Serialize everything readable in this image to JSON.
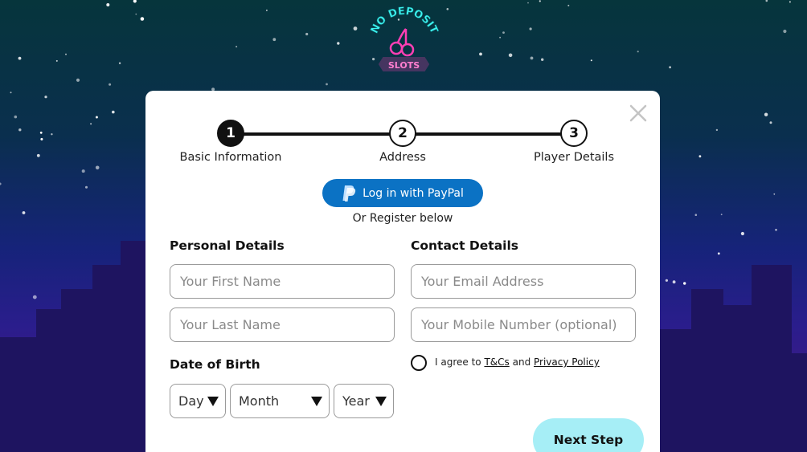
{
  "logo": {
    "text_top": "NO DEPOSIT",
    "text_bottom": "SLOTS"
  },
  "steps": [
    {
      "number": "1",
      "label": "Basic Information",
      "active": true
    },
    {
      "number": "2",
      "label": "Address",
      "active": false
    },
    {
      "number": "3",
      "label": "Player Details",
      "active": false
    }
  ],
  "paypal": {
    "label": "Log in with PayPal"
  },
  "or_text": "Or Register below",
  "personal": {
    "title": "Personal Details",
    "first_name_placeholder": "Your First Name",
    "last_name_placeholder": "Your Last Name"
  },
  "contact": {
    "title": "Contact Details",
    "email_placeholder": "Your Email Address",
    "mobile_placeholder": "Your Mobile Number (optional)"
  },
  "dob": {
    "title": "Date of Birth",
    "day": "Day",
    "month": "Month",
    "year": "Year"
  },
  "agree": {
    "prefix": "I agree to",
    "tcs": "T&Cs",
    "and": "and",
    "privacy": "Privacy Policy"
  },
  "next_label": "Next Step",
  "colors": {
    "paypal": "#0b72c4",
    "next_button": "#a6eef6",
    "logo_cyan": "#3ef3f0",
    "logo_pink": "#ff3fb4"
  },
  "icons": {
    "close": "close-icon",
    "paypal": "paypal-logo-icon",
    "dropdown": "triangle-down-icon"
  }
}
